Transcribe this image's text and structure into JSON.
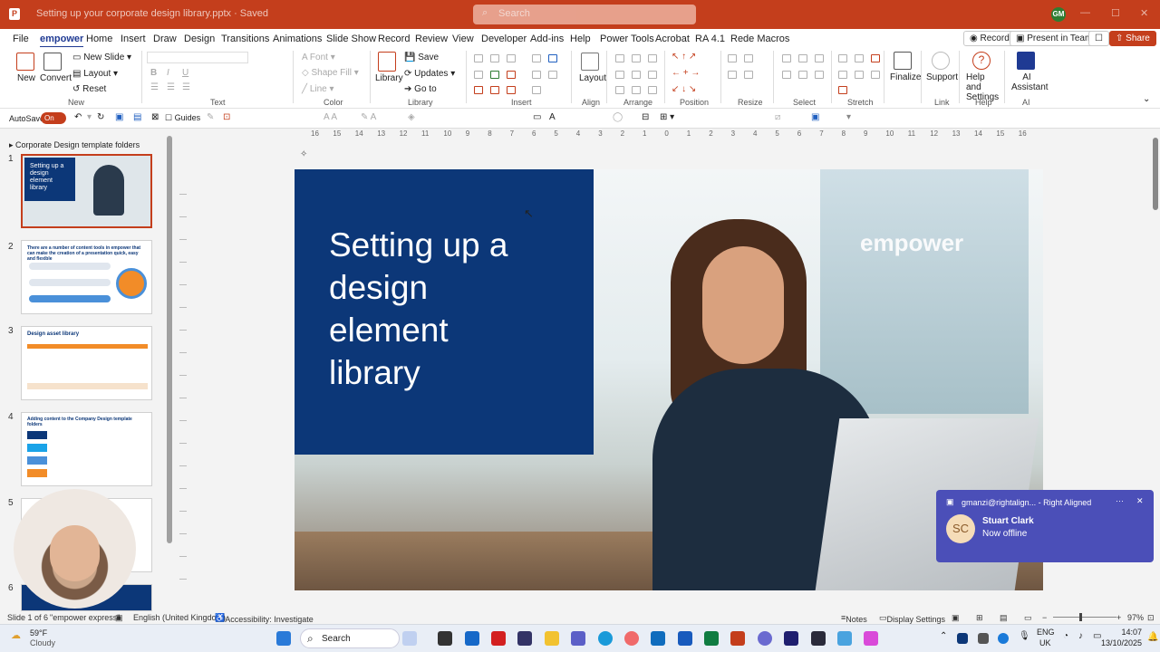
{
  "titlebar": {
    "quick_access": "Setting up your corporate design library.pptx · Saved",
    "search_placeholder": "Search",
    "user_initials": "GM"
  },
  "menu": {
    "tabs": [
      "File",
      "empower",
      "Home",
      "Insert",
      "Draw",
      "Design",
      "Transitions",
      "Animations",
      "Slide Show",
      "Record",
      "Review",
      "View",
      "Developer",
      "Add-ins",
      "Help",
      "Power Tools",
      "Acrobat",
      "RA 4.1",
      "Rede Macros"
    ],
    "active_tab": "empower",
    "record_button": "Record",
    "present_button": "Present in Teams",
    "share_button": "Share"
  },
  "ribbon": {
    "new_label": "New",
    "convert_label": "Convert",
    "new_slide": "New Slide",
    "layout": "Layout",
    "reset": "Reset",
    "group_new": "New",
    "font_label": "Font",
    "shape_fill": "Shape Fill",
    "line_label": "Line",
    "group_text": "Text",
    "group_color": "Color",
    "library_label": "Library",
    "save_label": "Save",
    "updates_label": "Updates",
    "goto_label": "Go to",
    "group_library": "Library",
    "group_insert": "Insert",
    "layout_btn": "Layout",
    "group_align": "Align",
    "group_arrange": "Arrange",
    "group_position": "Position",
    "group_resize": "Resize",
    "group_select": "Select",
    "group_stretch": "Stretch",
    "finalize": "Finalize",
    "support": "Support",
    "help_settings": "Help and Settings",
    "ai_assistant": "AI Assistant",
    "group_link": "Link",
    "group_help": "Help",
    "group_ai": "AI"
  },
  "toolbar2": {
    "autosave_label": "AutoSave",
    "autosave_state": "On",
    "guides_label": "Guides"
  },
  "slides_panel": {
    "section_title": "Corporate Design template folders",
    "thumbs": [
      {
        "num": "1",
        "title": "Setting up a design element library"
      },
      {
        "num": "2",
        "title": "There are a number of content tools in empower that can make the creation of a presentation quick, easy and flexible"
      },
      {
        "num": "3",
        "title": "Design asset library"
      },
      {
        "num": "4",
        "title": "Adding content to the Company Design template folders"
      },
      {
        "num": "5",
        "title": ""
      },
      {
        "num": "6",
        "title": ""
      }
    ]
  },
  "ruler_ticks": [
    "16",
    "15",
    "14",
    "13",
    "12",
    "11",
    "10",
    "9",
    "8",
    "7",
    "6",
    "5",
    "4",
    "3",
    "2",
    "1",
    "0",
    "1",
    "2",
    "3",
    "4",
    "5",
    "6",
    "7",
    "8",
    "9",
    "10",
    "11",
    "12",
    "13",
    "14",
    "15",
    "16"
  ],
  "slide": {
    "title_lines": [
      "Setting up a",
      "design",
      "element",
      "library"
    ],
    "logo_text": "empower"
  },
  "notification": {
    "header": "gmanzi@rightalign... - Right Aligned",
    "initials": "SC",
    "name": "Stuart Clark",
    "status": "Now offline"
  },
  "statusbar": {
    "slide_info": "Slide 1 of 6",
    "theme": "\"empower express\"",
    "language": "English (United Kingdom)",
    "accessibility": "Accessibility: Investigate",
    "notes": "Notes",
    "display_settings": "Display Settings",
    "zoom": "97%"
  },
  "taskbar": {
    "weather_temp": "59°F",
    "weather_desc": "Cloudy",
    "search_label": "Search",
    "lang": "ENG",
    "region": "UK",
    "time": "14:07",
    "date": "13/10/2025"
  },
  "colors": {
    "accent": "#c43e1c",
    "slide_blue": "#0c3778",
    "teams_purple": "#4b4fb8"
  }
}
